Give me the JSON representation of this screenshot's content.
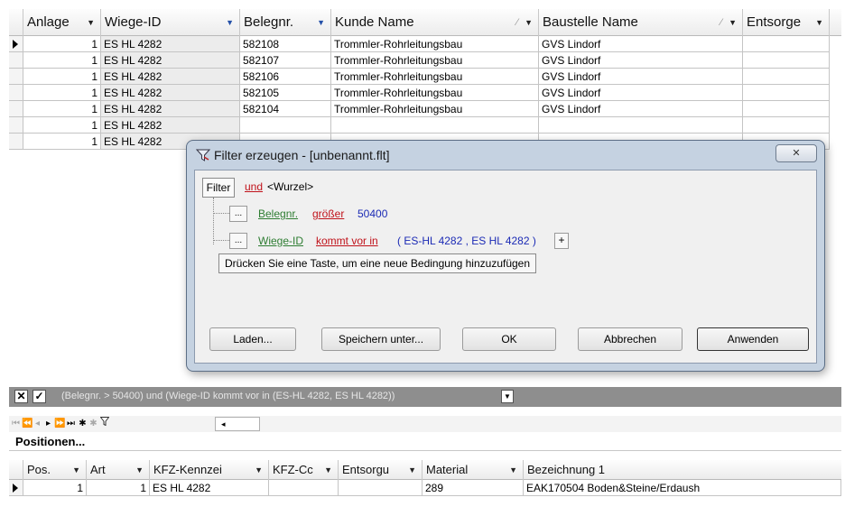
{
  "top_grid": {
    "columns": [
      {
        "label": "Anlage",
        "dropdown": true
      },
      {
        "label": "Wiege-ID",
        "dropdown": true
      },
      {
        "label": "Belegnr.",
        "dropdown": true
      },
      {
        "label": "Kunde Name",
        "dropdown": true
      },
      {
        "label": "Baustelle Name",
        "dropdown": true
      },
      {
        "label": "Entsorge",
        "dropdown": true
      }
    ],
    "rows": [
      {
        "anlage": "1",
        "wiege": "ES HL 4282",
        "beleg": "582108",
        "kunde": "Trommler-Rohrleitungsbau",
        "baustelle": "GVS Lindorf",
        "current": true
      },
      {
        "anlage": "1",
        "wiege": "ES HL 4282",
        "beleg": "582107",
        "kunde": "Trommler-Rohrleitungsbau",
        "baustelle": "GVS Lindorf",
        "current": false
      },
      {
        "anlage": "1",
        "wiege": "ES HL 4282",
        "beleg": "582106",
        "kunde": "Trommler-Rohrleitungsbau",
        "baustelle": "GVS Lindorf",
        "current": false
      },
      {
        "anlage": "1",
        "wiege": "ES HL 4282",
        "beleg": "582105",
        "kunde": "Trommler-Rohrleitungsbau",
        "baustelle": "GVS Lindorf",
        "current": false
      },
      {
        "anlage": "1",
        "wiege": "ES HL 4282",
        "beleg": "582104",
        "kunde": "Trommler-Rohrleitungsbau",
        "baustelle": "GVS Lindorf",
        "current": false
      },
      {
        "anlage": "1",
        "wiege": "ES HL 4282",
        "beleg": "",
        "kunde": "",
        "baustelle": "",
        "current": false
      },
      {
        "anlage": "1",
        "wiege": "ES HL 4282",
        "beleg": "",
        "kunde": "",
        "baustelle": "",
        "current": false
      }
    ]
  },
  "dialog": {
    "title": "Filter erzeugen - [unbenannt.flt]",
    "close_label": "✕",
    "filter_label": "Filter",
    "root_operator": "und",
    "root_label": "<Wurzel>",
    "ellipsis": "...",
    "conditions": [
      {
        "field": "Belegnr.",
        "operator": "größer",
        "value": "50400"
      },
      {
        "field": "Wiege-ID",
        "operator": "kommt vor in",
        "value": "( ES-HL 4282 ,   ES HL 4282 )",
        "add": "+"
      }
    ],
    "hint": "Drücken Sie eine Taste, um eine neue Bedingung hinzuzufügen",
    "buttons": {
      "load": "Laden...",
      "save_as": "Speichern unter...",
      "ok": "OK",
      "cancel": "Abbrechen",
      "apply": "Anwenden"
    }
  },
  "filter_bar": {
    "expression": "(Belegnr. > 50400) und (Wiege-ID kommt vor in (ES-HL 4282, ES HL 4282))",
    "enabled": true
  },
  "navigator": {
    "buttons": [
      "first-icon",
      "prev-page-icon",
      "prev-icon",
      "next-icon",
      "next-page-icon",
      "last-icon",
      "insert-icon",
      "delete-icon",
      "filter-icon"
    ],
    "scroll_indicator": "◂"
  },
  "positions_label": "Positionen...",
  "bottom_grid": {
    "columns": [
      {
        "label": "Pos."
      },
      {
        "label": "Art"
      },
      {
        "label": "KFZ-Kennzei"
      },
      {
        "label": "KFZ-Cc"
      },
      {
        "label": "Entsorgu"
      },
      {
        "label": "Material"
      },
      {
        "label": "Bezeichnung 1"
      }
    ],
    "rows": [
      {
        "pos": "1",
        "art": "1",
        "kfz": "ES HL 4282",
        "kfzc": "",
        "ents": "",
        "material": "289",
        "bez": "EAK170504 Boden&Steine/Erdaush"
      }
    ]
  },
  "colors": {
    "operator_red": "#c0121a",
    "field_green": "#2e7d32",
    "value_blue": "#1c2bb5",
    "dialog_frame": "#c5d2e1",
    "filter_bar_bg": "#8e8e8e"
  }
}
